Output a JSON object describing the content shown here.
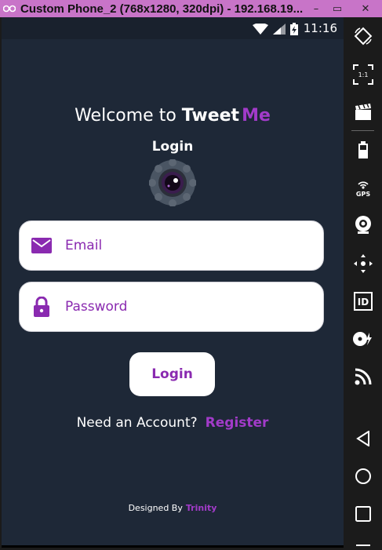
{
  "window": {
    "title": "Custom Phone_2 (768x1280, 320dpi) - 192.168.19...",
    "minimize": "–",
    "restore": "▭",
    "close": "✕"
  },
  "statusbar": {
    "time": "11:16"
  },
  "app": {
    "welcome_prefix": "Welcome to",
    "brand": "Tweet",
    "brand_accent": "Me",
    "heading": "Login",
    "email_placeholder": "Email",
    "password_placeholder": "Password",
    "login_button": "Login",
    "account_question": "Need an Account?",
    "register_link": "Register",
    "designed_by": "Designed By",
    "designer": "Trinity"
  },
  "toolbar": {
    "scale_label": "1:1",
    "gps_label": "GPS",
    "id_label": "ID"
  },
  "colors": {
    "background": "#1e2837",
    "accent": "#a23bc9",
    "field_text": "#8a2ab0",
    "titlebar": "#c874c8"
  }
}
